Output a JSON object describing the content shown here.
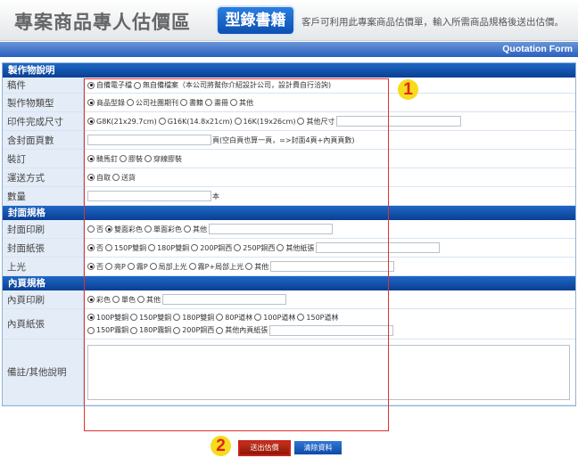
{
  "header": {
    "title": "專案商品專人估價區",
    "badge": "型錄書籍",
    "hint": "客戶可利用此專案商品估價單，輸入所需商品規格後送出估價。",
    "form_label": "Quotation Form"
  },
  "sections": {
    "production": "製作物說明",
    "cover": "封面規格",
    "inner": "內頁規格"
  },
  "rows": {
    "manuscript": {
      "label": "稿件",
      "options": [
        {
          "text": "自備電子檔",
          "checked": true
        },
        {
          "text": "無自備檔案（本公司將幫你介紹設計公司，設計費自行洽詢)",
          "checked": false
        }
      ]
    },
    "type": {
      "label": "製作物類型",
      "options": [
        {
          "text": "商品型錄",
          "checked": true
        },
        {
          "text": "公司社團期刊",
          "checked": false
        },
        {
          "text": "書籍",
          "checked": false
        },
        {
          "text": "畫冊",
          "checked": false
        },
        {
          "text": "其他",
          "checked": false
        }
      ]
    },
    "size": {
      "label": "印件完成尺寸",
      "options": [
        {
          "text": "G8K(21x29.7cm)",
          "checked": true
        },
        {
          "text": "G16K(14.8x21cm)",
          "checked": false
        },
        {
          "text": "16K(19x26cm)",
          "checked": false
        },
        {
          "text": "其他尺寸",
          "checked": false
        }
      ]
    },
    "pages": {
      "label": "含封面頁數",
      "suffix": "頁(空白頁也算一頁，=>封面4頁+內頁頁數)"
    },
    "binding": {
      "label": "裝訂",
      "options": [
        {
          "text": "騎馬釘",
          "checked": true
        },
        {
          "text": "膠裝",
          "checked": false
        },
        {
          "text": "穿線膠裝",
          "checked": false
        }
      ]
    },
    "shipping": {
      "label": "運送方式",
      "options": [
        {
          "text": "自取",
          "checked": true
        },
        {
          "text": "送貨",
          "checked": false
        }
      ]
    },
    "quantity": {
      "label": "數量",
      "suffix": "本"
    },
    "cover_print": {
      "label": "封面印刷",
      "options": [
        {
          "text": "否",
          "checked": false
        },
        {
          "text": "雙面彩色",
          "checked": true
        },
        {
          "text": "單面彩色",
          "checked": false
        },
        {
          "text": "其他",
          "checked": false
        }
      ]
    },
    "cover_paper": {
      "label": "封面紙張",
      "options": [
        {
          "text": "否",
          "checked": true
        },
        {
          "text": "150P雙銅",
          "checked": false
        },
        {
          "text": "180P雙銅",
          "checked": false
        },
        {
          "text": "200P銅西",
          "checked": false
        },
        {
          "text": "250P銅西",
          "checked": false
        },
        {
          "text": "其他紙張",
          "checked": false
        }
      ]
    },
    "gloss": {
      "label": "上光",
      "options": [
        {
          "text": "否",
          "checked": true
        },
        {
          "text": "亮P",
          "checked": false
        },
        {
          "text": "霧P",
          "checked": false
        },
        {
          "text": "局部上光",
          "checked": false
        },
        {
          "text": "霧P+局部上光",
          "checked": false
        },
        {
          "text": "其他",
          "checked": false
        }
      ]
    },
    "inner_print": {
      "label": "內頁印刷",
      "options": [
        {
          "text": "彩色",
          "checked": true
        },
        {
          "text": "單色",
          "checked": false
        },
        {
          "text": "其他",
          "checked": false
        }
      ]
    },
    "inner_paper": {
      "label": "內頁紙張",
      "line1": [
        {
          "text": "100P雙銅",
          "checked": true
        },
        {
          "text": "150P雙銅",
          "checked": false
        },
        {
          "text": "180P雙銅",
          "checked": false
        },
        {
          "text": "80P道林",
          "checked": false
        },
        {
          "text": "100P道林",
          "checked": false
        },
        {
          "text": "150P道林",
          "checked": false
        }
      ],
      "line2": [
        {
          "text": "150P霧銅",
          "checked": false
        },
        {
          "text": "180P霧銅",
          "checked": false
        },
        {
          "text": "200P銅西",
          "checked": false
        },
        {
          "text": "其他內頁紙張",
          "checked": false
        }
      ]
    },
    "notes": {
      "label": "備註/其他說明"
    }
  },
  "buttons": {
    "submit": "送出估價",
    "clear": "清除資料"
  },
  "steps": {
    "one": "1",
    "two": "2"
  },
  "colors": {
    "brand_blue": "#0d4fb0",
    "section_blue": "#0a3f93",
    "label_bg": "#e4edf7",
    "highlight_red": "#e0312f",
    "step_yellow": "#f6dc1c"
  }
}
